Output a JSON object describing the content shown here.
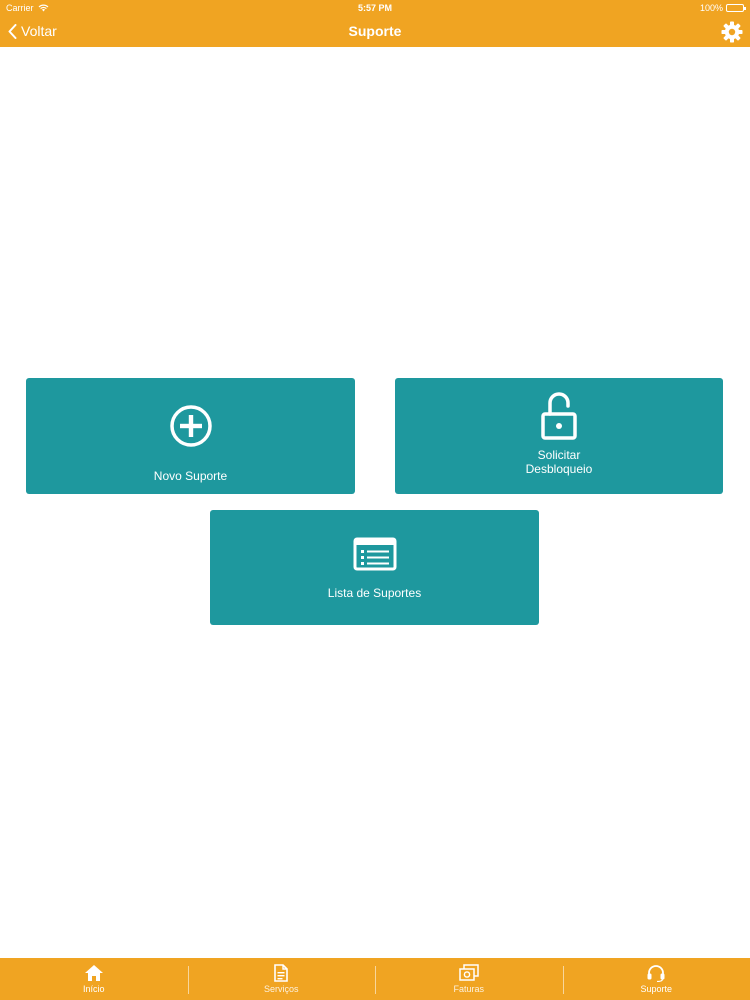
{
  "status_bar": {
    "carrier": "Carrier",
    "time": "5:57 PM",
    "battery": "100%",
    "battery_level": 1.0
  },
  "nav": {
    "back_label": "Voltar",
    "title": "Suporte",
    "settings_icon": "gear-icon"
  },
  "cards": [
    {
      "label": "Novo Suporte",
      "icon": "plus-circle-icon"
    },
    {
      "label_line1": "Solicitar",
      "label_line2": "Desbloqueio",
      "icon": "unlock-icon"
    },
    {
      "label": "Lista de Suportes",
      "icon": "list-icon"
    }
  ],
  "tabbar": [
    {
      "label": "Início",
      "icon": "home-icon"
    },
    {
      "label": "Serviços",
      "icon": "document-icon"
    },
    {
      "label": "Faturas",
      "icon": "invoice-icon"
    },
    {
      "label": "Suporte",
      "icon": "headset-icon"
    }
  ],
  "colors": {
    "bar": "#F0A422",
    "card": "#1E989E",
    "background": "#FFFFFF"
  }
}
